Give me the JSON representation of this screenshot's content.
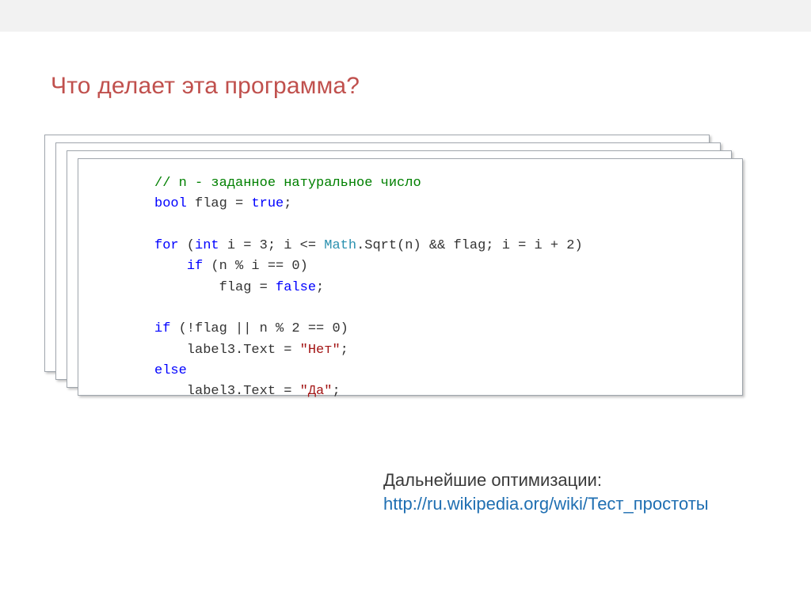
{
  "title": "Что делает эта программа?",
  "code": {
    "c01": "// n - заданное натуральное число",
    "c02a": "bool",
    "c02b": " flag = ",
    "c02c": "true",
    "c02d": ";",
    "c03a": "for",
    "c03b": " (",
    "c03c": "int",
    "c03d": " i = 3; i <= ",
    "c03e": "Math",
    "c03f": ".Sqrt(n) && flag; i = i + 2)",
    "c04a": "    ",
    "c04b": "if",
    "c04c": " (n % i == 0)",
    "c05a": "        flag = ",
    "c05b": "false",
    "c05c": ";",
    "c06a": "if",
    "c06b": " (!flag || n % 2 == 0)",
    "c07a": "    label3.Text = ",
    "c07b": "\"Нет\"",
    "c07c": ";",
    "c08a": "else",
    "c09a": "    label3.Text = ",
    "c09b": "\"Да\"",
    "c09c": ";"
  },
  "footnote": {
    "label": "Дальнейшие оптимизации:",
    "url_text": "http://ru.wikipedia.org/wiki/Тест_простоты",
    "url_href": "http://ru.wikipedia.org/wiki/Тест_простоты"
  }
}
